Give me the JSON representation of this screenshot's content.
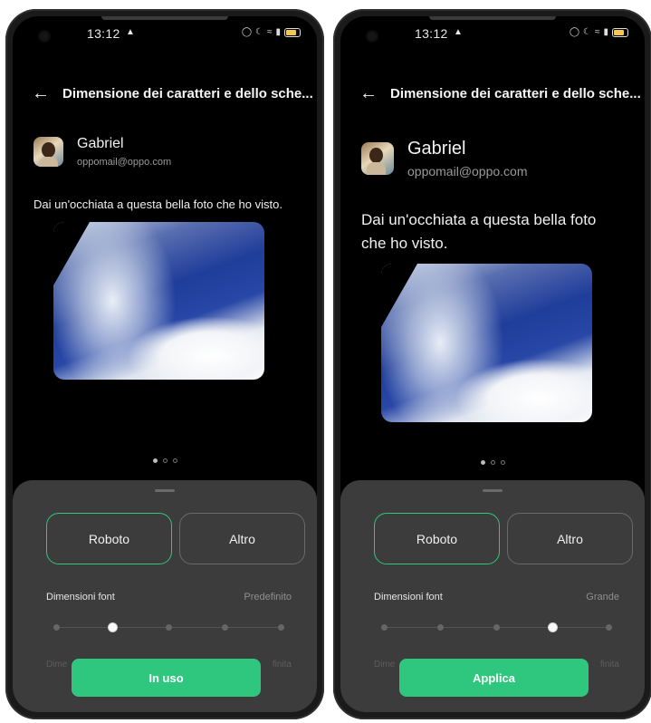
{
  "phones": [
    {
      "status": {
        "time": "13:12"
      },
      "header": {
        "title": "Dimensione dei caratteri e dello sche..."
      },
      "contact": {
        "name": "Gabriel",
        "email": "oppomail@oppo.com"
      },
      "message": "Dai un'occhiata a questa bella foto che ho visto.",
      "fonts": {
        "selected": "Roboto",
        "options": [
          "Roboto",
          "Altro"
        ]
      },
      "font_size": {
        "label": "Dimensioni font",
        "value": "Predefinito",
        "level_index": 1,
        "levels": 5
      },
      "hidden_row": {
        "left": "Dime",
        "right": "finita"
      },
      "action_label": "In uso"
    },
    {
      "status": {
        "time": "13:12"
      },
      "header": {
        "title": "Dimensione dei caratteri e dello sche..."
      },
      "contact": {
        "name": "Gabriel",
        "email": "oppomail@oppo.com"
      },
      "message": "Dai un'occhiata a questa bella foto che ho visto.",
      "fonts": {
        "selected": "Roboto",
        "options": [
          "Roboto",
          "Altro"
        ]
      },
      "font_size": {
        "label": "Dimensioni font",
        "value": "Grande",
        "level_index": 3,
        "levels": 5
      },
      "hidden_row": {
        "left": "Dime",
        "right": "finita"
      },
      "action_label": "Applica"
    }
  ],
  "colors": {
    "accent": "#2fc67d",
    "sheet": "#3c3c3c",
    "background": "#000000"
  },
  "icons": [
    "back-arrow-icon",
    "warning-icon",
    "water-drop-icon",
    "moon-icon",
    "wifi-icon",
    "signal-icon",
    "battery-icon"
  ]
}
